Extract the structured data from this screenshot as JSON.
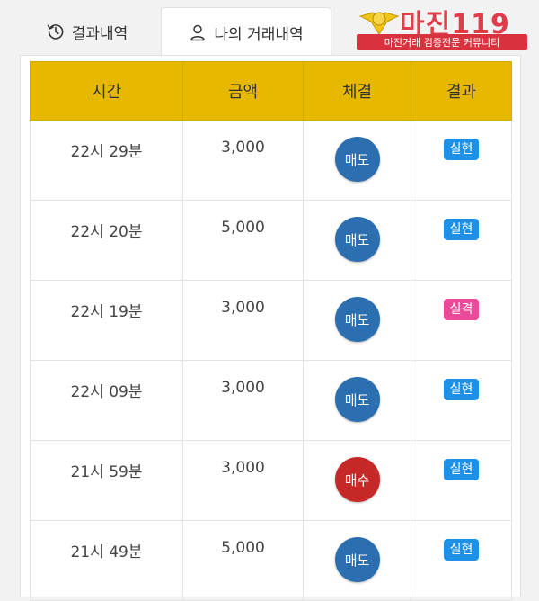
{
  "tabs": {
    "history_label": "결과내역",
    "mine_label": "나의 거래내역"
  },
  "logo": {
    "title": "마진119",
    "subtitle": "마진거래 검증전문 커뮤니티"
  },
  "table": {
    "headers": [
      "시간",
      "금액",
      "체결",
      "결과"
    ],
    "rows": [
      {
        "time": "22시 29분",
        "amount": "3,000",
        "trade": "매도",
        "result": "실현"
      },
      {
        "time": "22시 20분",
        "amount": "5,000",
        "trade": "매도",
        "result": "실현"
      },
      {
        "time": "22시 19분",
        "amount": "3,000",
        "trade": "매도",
        "result": "실격"
      },
      {
        "time": "22시 09분",
        "amount": "3,000",
        "trade": "매도",
        "result": "실현"
      },
      {
        "time": "21시 59분",
        "amount": "3,000",
        "trade": "매수",
        "result": "실현"
      },
      {
        "time": "21시 49분",
        "amount": "5,000",
        "trade": "매도",
        "result": "실현"
      }
    ]
  },
  "colors": {
    "header_bg": "#e6b800",
    "sell": "#2c6fb0",
    "buy": "#c62828",
    "hit_badge": "#1e90e6",
    "miss_badge": "#e94a9a",
    "logo_red": "#e23b4a"
  },
  "icons": {
    "history_tab": "history-clock-icon",
    "mine_tab": "user-icon"
  }
}
